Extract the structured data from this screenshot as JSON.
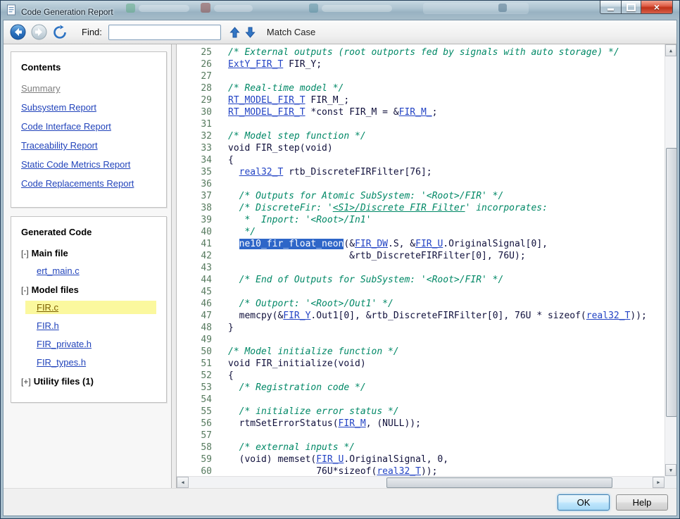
{
  "window": {
    "title": "Code Generation Report"
  },
  "toolbar": {
    "find_label": "Find:",
    "find_value": "",
    "match_case_label": "Match Case"
  },
  "sidebar": {
    "contents": {
      "heading": "Contents",
      "links": [
        {
          "label": "Summary",
          "muted": true
        },
        {
          "label": "Subsystem Report"
        },
        {
          "label": "Code Interface Report"
        },
        {
          "label": "Traceability Report"
        },
        {
          "label": "Static Code Metrics Report"
        },
        {
          "label": "Code Replacements Report"
        }
      ]
    },
    "generated_code": {
      "heading": "Generated Code",
      "tree": [
        {
          "kind": "group",
          "expander": "[-]",
          "label": "Main file"
        },
        {
          "kind": "file",
          "label": "ert_main.c"
        },
        {
          "kind": "group",
          "expander": "[-]",
          "label": "Model files"
        },
        {
          "kind": "file",
          "label": "FIR.c",
          "selected": true
        },
        {
          "kind": "file",
          "label": "FIR.h"
        },
        {
          "kind": "file",
          "label": "FIR_private.h"
        },
        {
          "kind": "file",
          "label": "FIR_types.h"
        },
        {
          "kind": "group",
          "expander": "[+]",
          "label": "Utility files (1)"
        }
      ]
    }
  },
  "code": {
    "lines": [
      {
        "n": 25,
        "segs": [
          {
            "c": "cmt",
            "t": "/* External outputs (root outports fed by signals with auto storage) */"
          }
        ]
      },
      {
        "n": 26,
        "segs": [
          {
            "c": "lnk",
            "t": "ExtY_FIR_T"
          },
          {
            "c": "pln",
            "t": " FIR_Y;"
          }
        ]
      },
      {
        "n": 27,
        "segs": []
      },
      {
        "n": 28,
        "segs": [
          {
            "c": "cmt",
            "t": "/* Real-time model */"
          }
        ]
      },
      {
        "n": 29,
        "segs": [
          {
            "c": "lnk",
            "t": "RT_MODEL_FIR_T"
          },
          {
            "c": "pln",
            "t": " FIR_M_;"
          }
        ]
      },
      {
        "n": 30,
        "segs": [
          {
            "c": "lnk",
            "t": "RT_MODEL_FIR_T"
          },
          {
            "c": "pln",
            "t": " *const FIR_M = &"
          },
          {
            "c": "lnk",
            "t": "FIR_M_"
          },
          {
            "c": "pln",
            "t": ";"
          }
        ]
      },
      {
        "n": 31,
        "segs": []
      },
      {
        "n": 32,
        "segs": [
          {
            "c": "cmt",
            "t": "/* Model step function */"
          }
        ]
      },
      {
        "n": 33,
        "segs": [
          {
            "c": "pln",
            "t": "void FIR_step(void)"
          }
        ]
      },
      {
        "n": 34,
        "segs": [
          {
            "c": "pln",
            "t": "{"
          }
        ]
      },
      {
        "n": 35,
        "segs": [
          {
            "c": "pln",
            "t": "  "
          },
          {
            "c": "lnk",
            "t": "real32_T"
          },
          {
            "c": "pln",
            "t": " rtb_DiscreteFIRFilter[76];"
          }
        ]
      },
      {
        "n": 36,
        "segs": []
      },
      {
        "n": 37,
        "segs": [
          {
            "c": "cmt",
            "t": "  /* Outputs for Atomic SubSystem: '<Root>/FIR' */"
          }
        ]
      },
      {
        "n": 38,
        "segs": [
          {
            "c": "cmt",
            "t": "  /* DiscreteFir: '"
          },
          {
            "c": "cmtlnk",
            "t": "<S1>/Discrete FIR Filter"
          },
          {
            "c": "cmt",
            "t": "' incorporates:"
          }
        ]
      },
      {
        "n": 39,
        "segs": [
          {
            "c": "cmt",
            "t": "   *  Inport: '<Root>/In1'"
          }
        ]
      },
      {
        "n": 40,
        "segs": [
          {
            "c": "cmt",
            "t": "   */"
          }
        ]
      },
      {
        "n": 41,
        "segs": [
          {
            "c": "pln",
            "t": "  "
          },
          {
            "c": "sel",
            "t": "ne10_fir_float_neon"
          },
          {
            "c": "pln",
            "t": "(&"
          },
          {
            "c": "lnk",
            "t": "FIR_DW"
          },
          {
            "c": "pln",
            "t": ".S, &"
          },
          {
            "c": "lnk",
            "t": "FIR_U"
          },
          {
            "c": "pln",
            "t": ".OriginalSignal[0],"
          }
        ]
      },
      {
        "n": 42,
        "segs": [
          {
            "c": "pln",
            "t": "                      &rtb_DiscreteFIRFilter[0], 76U);"
          }
        ]
      },
      {
        "n": 43,
        "segs": []
      },
      {
        "n": 44,
        "segs": [
          {
            "c": "cmt",
            "t": "  /* End of Outputs for SubSystem: '<Root>/FIR' */"
          }
        ]
      },
      {
        "n": 45,
        "segs": []
      },
      {
        "n": 46,
        "segs": [
          {
            "c": "cmt",
            "t": "  /* Outport: '<Root>/Out1' */"
          }
        ]
      },
      {
        "n": 47,
        "segs": [
          {
            "c": "pln",
            "t": "  memcpy(&"
          },
          {
            "c": "lnk",
            "t": "FIR_Y"
          },
          {
            "c": "pln",
            "t": ".Out1[0], &rtb_DiscreteFIRFilter[0], 76U * sizeof("
          },
          {
            "c": "lnk",
            "t": "real32_T"
          },
          {
            "c": "pln",
            "t": "));"
          }
        ]
      },
      {
        "n": 48,
        "segs": [
          {
            "c": "pln",
            "t": "}"
          }
        ]
      },
      {
        "n": 49,
        "segs": []
      },
      {
        "n": 50,
        "segs": [
          {
            "c": "cmt",
            "t": "/* Model initialize function */"
          }
        ]
      },
      {
        "n": 51,
        "segs": [
          {
            "c": "pln",
            "t": "void FIR_initialize(void)"
          }
        ]
      },
      {
        "n": 52,
        "segs": [
          {
            "c": "pln",
            "t": "{"
          }
        ]
      },
      {
        "n": 53,
        "segs": [
          {
            "c": "cmt",
            "t": "  /* Registration code */"
          }
        ]
      },
      {
        "n": 54,
        "segs": []
      },
      {
        "n": 55,
        "segs": [
          {
            "c": "cmt",
            "t": "  /* initialize error status */"
          }
        ]
      },
      {
        "n": 56,
        "segs": [
          {
            "c": "pln",
            "t": "  rtmSetErrorStatus("
          },
          {
            "c": "lnk",
            "t": "FIR_M"
          },
          {
            "c": "pln",
            "t": ", (NULL));"
          }
        ]
      },
      {
        "n": 57,
        "segs": []
      },
      {
        "n": 58,
        "segs": [
          {
            "c": "cmt",
            "t": "  /* external inputs */"
          }
        ]
      },
      {
        "n": 59,
        "segs": [
          {
            "c": "pln",
            "t": "  (void) memset("
          },
          {
            "c": "lnk",
            "t": "FIR_U"
          },
          {
            "c": "pln",
            "t": ".OriginalSignal, 0,"
          }
        ]
      },
      {
        "n": 60,
        "segs": [
          {
            "c": "pln",
            "t": "                76U*sizeof("
          },
          {
            "c": "lnk",
            "t": "real32_T"
          },
          {
            "c": "pln",
            "t": "));"
          }
        ]
      }
    ]
  },
  "footer": {
    "ok_label": "OK",
    "help_label": "Help"
  },
  "icons": {
    "scroll_up": "▲",
    "scroll_down": "▼",
    "scroll_left": "◀",
    "scroll_right": "▶",
    "close": "×"
  },
  "colors": {
    "selection_highlight": "#2e66c8",
    "selected_file_background": "#fbf89e",
    "link_blue": "#2243c4",
    "comment_green": "#008866",
    "close_button_red": "#c03219"
  }
}
